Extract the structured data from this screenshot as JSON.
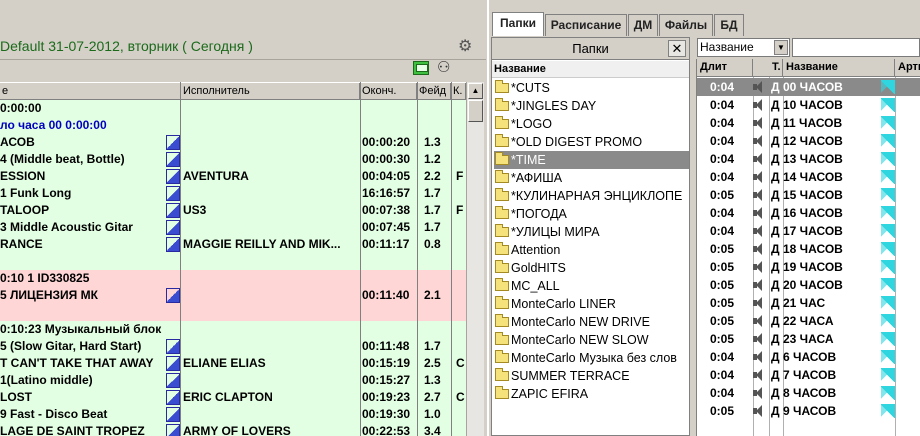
{
  "left": {
    "day_title": "Default 31-07-2012, вторник ( Сегодня )",
    "columns": [
      "е",
      "Исполнитель",
      "Оконч.",
      "Фейд",
      "К."
    ],
    "rows": [
      {
        "title": "0:00:00",
        "title_color": "normal",
        "mark": false,
        "artist": "",
        "end": "",
        "fade": "",
        "k": "",
        "bg": "green"
      },
      {
        "title": "ло часа 00 0:00:00",
        "title_color": "blue",
        "mark": false,
        "artist": "",
        "end": "",
        "fade": "",
        "k": "",
        "bg": "green"
      },
      {
        "title": "АСОВ",
        "mark": true,
        "artist": "",
        "end": "00:00:20",
        "fade": "1.3",
        "k": "",
        "bg": "green"
      },
      {
        "title": "4 (Middle beat, Bottle)",
        "mark": true,
        "artist": "",
        "end": "00:00:30",
        "fade": "1.2",
        "k": "",
        "bg": "green"
      },
      {
        "title": "ESSION",
        "mark": true,
        "artist": "AVENTURA",
        "end": "00:04:05",
        "fade": "2.2",
        "k": "F",
        "bg": "green"
      },
      {
        "title": "1 Funk Long",
        "mark": true,
        "artist": "",
        "end": "16:16:57",
        "fade": "1.7",
        "k": "",
        "bg": "green"
      },
      {
        "title": "TALOOP",
        "mark": true,
        "artist": "US3",
        "end": "00:07:38",
        "fade": "1.7",
        "k": "F",
        "bg": "green"
      },
      {
        "title": "3 Middle Acoustic Gitar",
        "mark": true,
        "artist": "",
        "end": "00:07:45",
        "fade": "1.7",
        "k": "",
        "bg": "green"
      },
      {
        "title": "RANCE",
        "mark": true,
        "artist": "MAGGIE REILLY AND MIK...",
        "end": "00:11:17",
        "fade": "0.8",
        "k": "",
        "bg": "green"
      },
      {
        "title": "",
        "mark": false,
        "artist": "",
        "end": "",
        "fade": "",
        "k": "",
        "bg": "green"
      },
      {
        "title": "0:10 1 ID330825",
        "mark": false,
        "artist": "",
        "end": "",
        "fade": "",
        "k": "",
        "bg": "pink"
      },
      {
        "title": "5 ЛИЦЕНЗИЯ МК",
        "mark": true,
        "artist": "",
        "end": "00:11:40",
        "fade": "2.1",
        "k": "",
        "bg": "pink"
      },
      {
        "title": "",
        "mark": false,
        "artist": "",
        "end": "",
        "fade": "",
        "k": "",
        "bg": "pink"
      },
      {
        "title": "0:10:23 Музыкальный блок",
        "mark": false,
        "artist": "",
        "end": "",
        "fade": "",
        "k": "",
        "bg": "green"
      },
      {
        "title": "5 (Slow Gitar, Hard Start)",
        "mark": true,
        "artist": "",
        "end": "00:11:48",
        "fade": "1.7",
        "k": "",
        "bg": "green"
      },
      {
        "title": "T CAN'T TAKE THAT AWAY",
        "mark": true,
        "artist": "ELIANE ELIAS",
        "end": "00:15:19",
        "fade": "2.5",
        "k": "C",
        "bg": "green"
      },
      {
        "title": "1(Latino middle)",
        "mark": true,
        "artist": "",
        "end": "00:15:27",
        "fade": "1.3",
        "k": "",
        "bg": "green"
      },
      {
        "title": "LOST",
        "mark": true,
        "artist": "ERIC CLAPTON",
        "end": "00:19:23",
        "fade": "2.7",
        "k": "C",
        "bg": "green"
      },
      {
        "title": "9 Fast - Disco Beat",
        "mark": true,
        "artist": "",
        "end": "00:19:30",
        "fade": "1.0",
        "k": "",
        "bg": "green"
      },
      {
        "title": "LAGE DE SAINT TROPEZ",
        "mark": true,
        "artist": "ARMY OF LOVERS",
        "end": "00:22:53",
        "fade": "3.4",
        "k": "",
        "bg": "green"
      }
    ]
  },
  "tabs": [
    "Папки",
    "Расписание",
    "ДМ",
    "Файлы",
    "БД"
  ],
  "folders": {
    "title": "Папки",
    "close": "✕",
    "column": "Название",
    "items": [
      "*CUTS",
      "*JINGLES DAY",
      "*LOGO",
      "*OLD DIGEST PROMO",
      "*TIME",
      "*АФИША",
      "*КУЛИНАРНАЯ ЭНЦИКЛОПЕ",
      "*ПОГОДА",
      "*УЛИЦЫ МИРА",
      "Attention",
      "GoldHITS",
      "MC_ALL",
      "MonteCarlo LINER",
      "MonteCarlo NEW DRIVE",
      "MonteCarlo NEW SLOW",
      "MonteCarlo Музыка без слов",
      "SUMMER TERRACE",
      "ZAPIC EFIRA"
    ],
    "selected_index": 4
  },
  "sort": {
    "value": "Название"
  },
  "tracks": {
    "columns": [
      "Длит",
      "Т.",
      "Название",
      "Арти"
    ],
    "selected_index": 0,
    "items": [
      {
        "dur": "0:04",
        "type": "Д",
        "name": "00 ЧАСОВ"
      },
      {
        "dur": "0:04",
        "type": "Д",
        "name": "10 ЧАСОВ"
      },
      {
        "dur": "0:04",
        "type": "Д",
        "name": "11 ЧАСОВ"
      },
      {
        "dur": "0:04",
        "type": "Д",
        "name": "12 ЧАСОВ"
      },
      {
        "dur": "0:04",
        "type": "Д",
        "name": "13 ЧАСОВ"
      },
      {
        "dur": "0:04",
        "type": "Д",
        "name": "14 ЧАСОВ"
      },
      {
        "dur": "0:05",
        "type": "Д",
        "name": "15 ЧАСОВ"
      },
      {
        "dur": "0:04",
        "type": "Д",
        "name": "16 ЧАСОВ"
      },
      {
        "dur": "0:04",
        "type": "Д",
        "name": "17 ЧАСОВ"
      },
      {
        "dur": "0:05",
        "type": "Д",
        "name": "18 ЧАСОВ"
      },
      {
        "dur": "0:05",
        "type": "Д",
        "name": "19 ЧАСОВ"
      },
      {
        "dur": "0:05",
        "type": "Д",
        "name": "20 ЧАСОВ"
      },
      {
        "dur": "0:05",
        "type": "Д",
        "name": "21 ЧАС"
      },
      {
        "dur": "0:05",
        "type": "Д",
        "name": "22 ЧАСА"
      },
      {
        "dur": "0:05",
        "type": "Д",
        "name": "23 ЧАСА"
      },
      {
        "dur": "0:04",
        "type": "Д",
        "name": "6 ЧАСОВ"
      },
      {
        "dur": "0:04",
        "type": "Д",
        "name": "7 ЧАСОВ"
      },
      {
        "dur": "0:04",
        "type": "Д",
        "name": "8 ЧАСОВ"
      },
      {
        "dur": "0:05",
        "type": "Д",
        "name": "9 ЧАСОВ"
      }
    ]
  },
  "icons": {
    "gear": "gear-icon",
    "speaker": "speaker-icon",
    "folder": "folder-icon",
    "cue": "cue-marker-icon"
  },
  "colors": {
    "playlist_bg": "#e3ffe3",
    "block_bg": "#ffd6d6",
    "selection": "#8a8a8a",
    "accent_blue": "#0000c0",
    "title_green": "#1a6a1a"
  }
}
